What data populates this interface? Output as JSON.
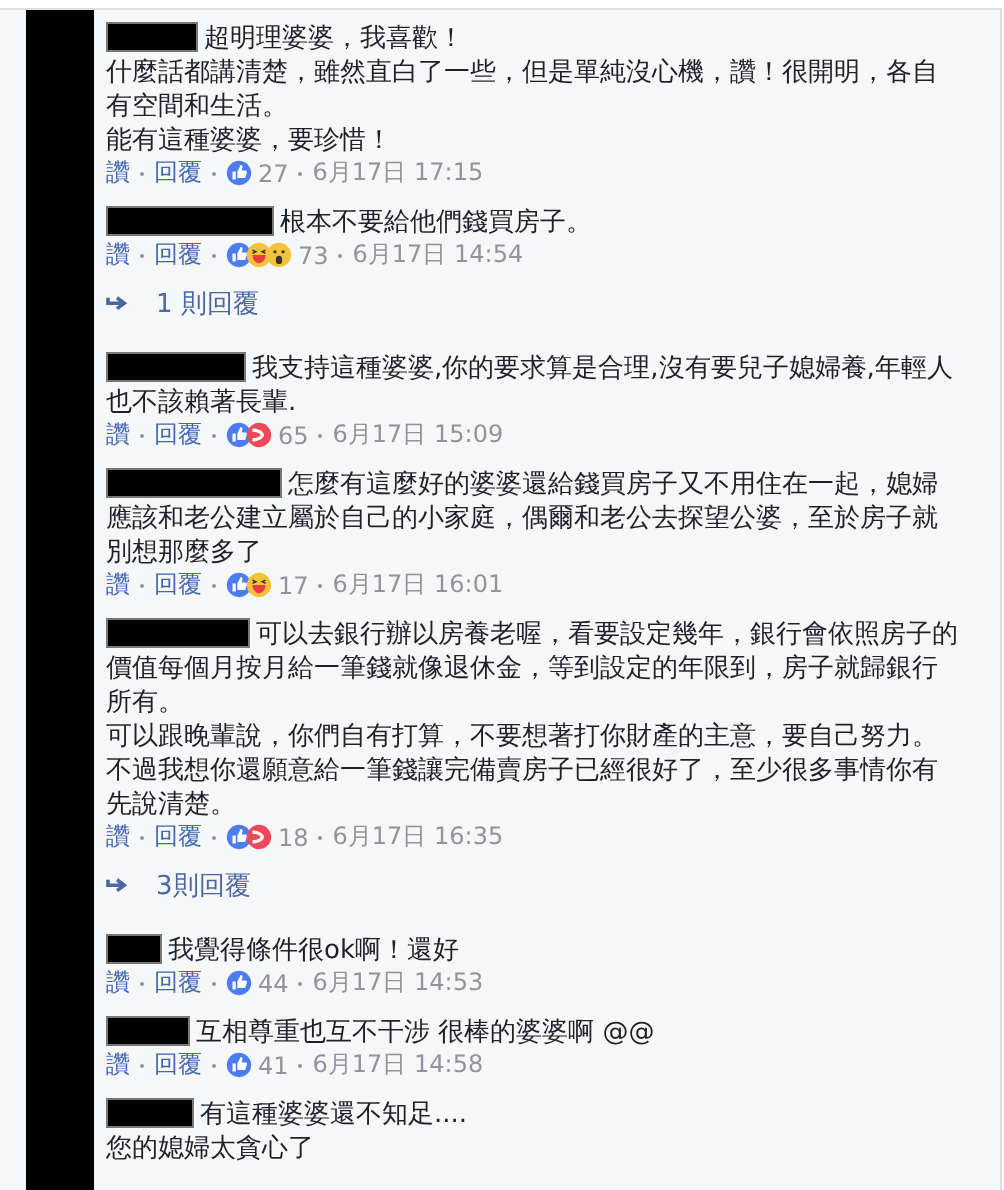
{
  "items": [
    {
      "kind": "comment",
      "lines": [
        "超明理婆婆，我喜歡！",
        "什麼話都講清楚，雖然直白了一些，但是單純沒心機，讚！很開明，各自",
        "有空間和生活。",
        "能有這種婆婆，要珍惜！"
      ],
      "like": "讚",
      "reply": "回覆",
      "reactions": [
        {
          "kind": "like"
        }
      ],
      "count": "27",
      "time": "6月17日 17:15"
    },
    {
      "kind": "comment",
      "lines": [
        "根本不要給他們錢買房子。"
      ],
      "like": "讚",
      "reply": "回覆",
      "reactions": [
        {
          "kind": "like"
        },
        {
          "kind": "haha"
        },
        {
          "kind": "wow"
        }
      ],
      "count": "73",
      "time": "6月17日 14:54"
    },
    {
      "kind": "replies",
      "label": "1 則回覆"
    },
    {
      "kind": "comment",
      "lines": [
        "我支持這種婆婆,你的要求算是合理,沒有要兒子媳婦養,年輕人",
        "也不該賴著長輩."
      ],
      "like": "讚",
      "reply": "回覆",
      "reactions": [
        {
          "kind": "like"
        },
        {
          "kind": "angry"
        }
      ],
      "count": "65",
      "time": "6月17日 15:09"
    },
    {
      "kind": "comment",
      "lines": [
        "怎麼有這麼好的婆婆還給錢買房子又不用住在一起，媳婦",
        "應該和老公建立屬於自己的小家庭，偶爾和老公去探望公婆，至於房子就",
        "別想那麼多了"
      ],
      "like": "讚",
      "reply": "回覆",
      "reactions": [
        {
          "kind": "like"
        },
        {
          "kind": "haha"
        }
      ],
      "count": "17",
      "time": "6月17日 16:01"
    },
    {
      "kind": "comment",
      "lines": [
        "可以去銀行辦以房養老喔，看要設定幾年，銀行會依照房子的",
        "價值每個月按月給一筆錢就像退休金，等到設定的年限到，房子就歸銀行",
        "所有。",
        "可以跟晚輩說，你們自有打算，不要想著打你財產的主意，要自己努力。",
        "不過我想你還願意給一筆錢讓完備賣房子已經很好了，至少很多事情你有",
        "先說清楚。"
      ],
      "like": "讚",
      "reply": "回覆",
      "reactions": [
        {
          "kind": "like"
        },
        {
          "kind": "angry"
        }
      ],
      "count": "18",
      "time": "6月17日 16:35"
    },
    {
      "kind": "replies",
      "label": "3則回覆"
    },
    {
      "kind": "comment",
      "lines": [
        "我覺得條件很ok啊！還好"
      ],
      "like": "讚",
      "reply": "回覆",
      "reactions": [
        {
          "kind": "like"
        }
      ],
      "count": "44",
      "time": "6月17日 14:53"
    },
    {
      "kind": "comment",
      "lines": [
        "互相尊重也互不干涉 很棒的婆婆啊 @@"
      ],
      "like": "讚",
      "reply": "回覆",
      "reactions": [
        {
          "kind": "like"
        }
      ],
      "count": "41",
      "time": "6月17日 14:58"
    },
    {
      "kind": "comment",
      "lines": [
        "有這種婆婆還不知足....",
        "您的媳婦太貪心了"
      ]
    }
  ]
}
